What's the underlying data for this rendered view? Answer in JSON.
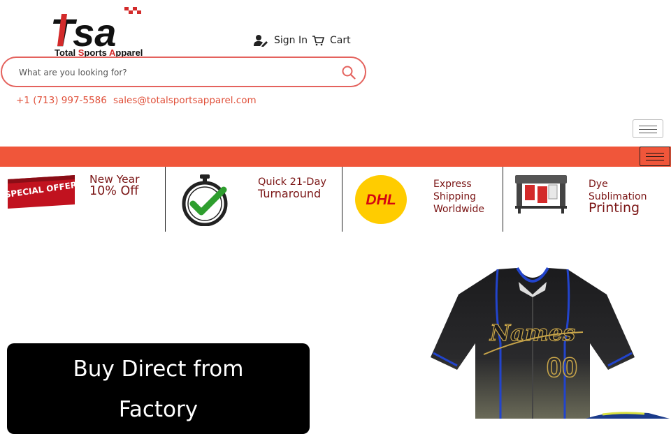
{
  "brand": {
    "logo_mark": "Tsa",
    "logo_text_parts": [
      "Total ",
      "S",
      "ports ",
      "A",
      "pparel"
    ]
  },
  "header": {
    "signin_label": "Sign In",
    "cart_label": "Cart",
    "signin_icon": "user-edit-icon",
    "cart_icon": "cart-icon"
  },
  "search": {
    "placeholder": "What are you looking for?",
    "value": "",
    "icon": "search-icon"
  },
  "contact": {
    "phone": "+1 (713) 997-5586",
    "email": "sales@totalsportsapparel.com"
  },
  "features": [
    {
      "line1": "New Year",
      "line2": "10% Off",
      "image_text": "SPECIAL OFFER"
    },
    {
      "line1": "Quick 21-Day",
      "line2": "Turnaround",
      "icon": "stopwatch-check-icon"
    },
    {
      "line1": "Express",
      "line2": "Shipping",
      "line3": "Worldwide",
      "image_text": "DHL"
    },
    {
      "line1": "Dye",
      "line2": "Sublimation",
      "line3": "Printing",
      "icon": "printer-icon"
    }
  ],
  "hero": {
    "title_line1": "Buy Direct from",
    "title_line2": "Factory",
    "jersey_text": "Names",
    "jersey_number": "00"
  },
  "colors": {
    "accent": "#f0563a",
    "link": "#e0503a",
    "feature_text": "#7a1414",
    "search_border": "#e4625d"
  }
}
